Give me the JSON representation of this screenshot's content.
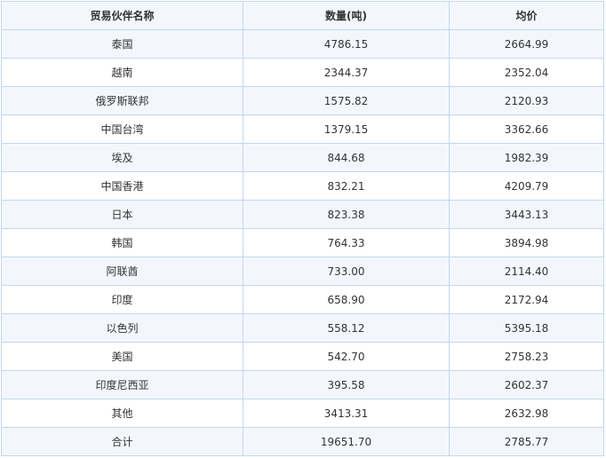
{
  "table": {
    "headers": {
      "partner": "贸易伙伴名称",
      "quantity": "数量(吨)",
      "avg_price": "均价"
    },
    "rows": [
      {
        "partner": "泰国",
        "quantity": "4786.15",
        "avg_price": "2664.99"
      },
      {
        "partner": "越南",
        "quantity": "2344.37",
        "avg_price": "2352.04"
      },
      {
        "partner": "俄罗斯联邦",
        "quantity": "1575.82",
        "avg_price": "2120.93"
      },
      {
        "partner": "中国台湾",
        "quantity": "1379.15",
        "avg_price": "3362.66"
      },
      {
        "partner": "埃及",
        "quantity": "844.68",
        "avg_price": "1982.39"
      },
      {
        "partner": "中国香港",
        "quantity": "832.21",
        "avg_price": "4209.79"
      },
      {
        "partner": "日本",
        "quantity": "823.38",
        "avg_price": "3443.13"
      },
      {
        "partner": "韩国",
        "quantity": "764.33",
        "avg_price": "3894.98"
      },
      {
        "partner": "阿联酋",
        "quantity": "733.00",
        "avg_price": "2114.40"
      },
      {
        "partner": "印度",
        "quantity": "658.90",
        "avg_price": "2172.94"
      },
      {
        "partner": "以色列",
        "quantity": "558.12",
        "avg_price": "5395.18"
      },
      {
        "partner": "美国",
        "quantity": "542.70",
        "avg_price": "2758.23"
      },
      {
        "partner": "印度尼西亚",
        "quantity": "395.58",
        "avg_price": "2602.37"
      },
      {
        "partner": "其他",
        "quantity": "3413.31",
        "avg_price": "2632.98"
      },
      {
        "partner": "合计",
        "quantity": "19651.70",
        "avg_price": "2785.77"
      }
    ]
  }
}
